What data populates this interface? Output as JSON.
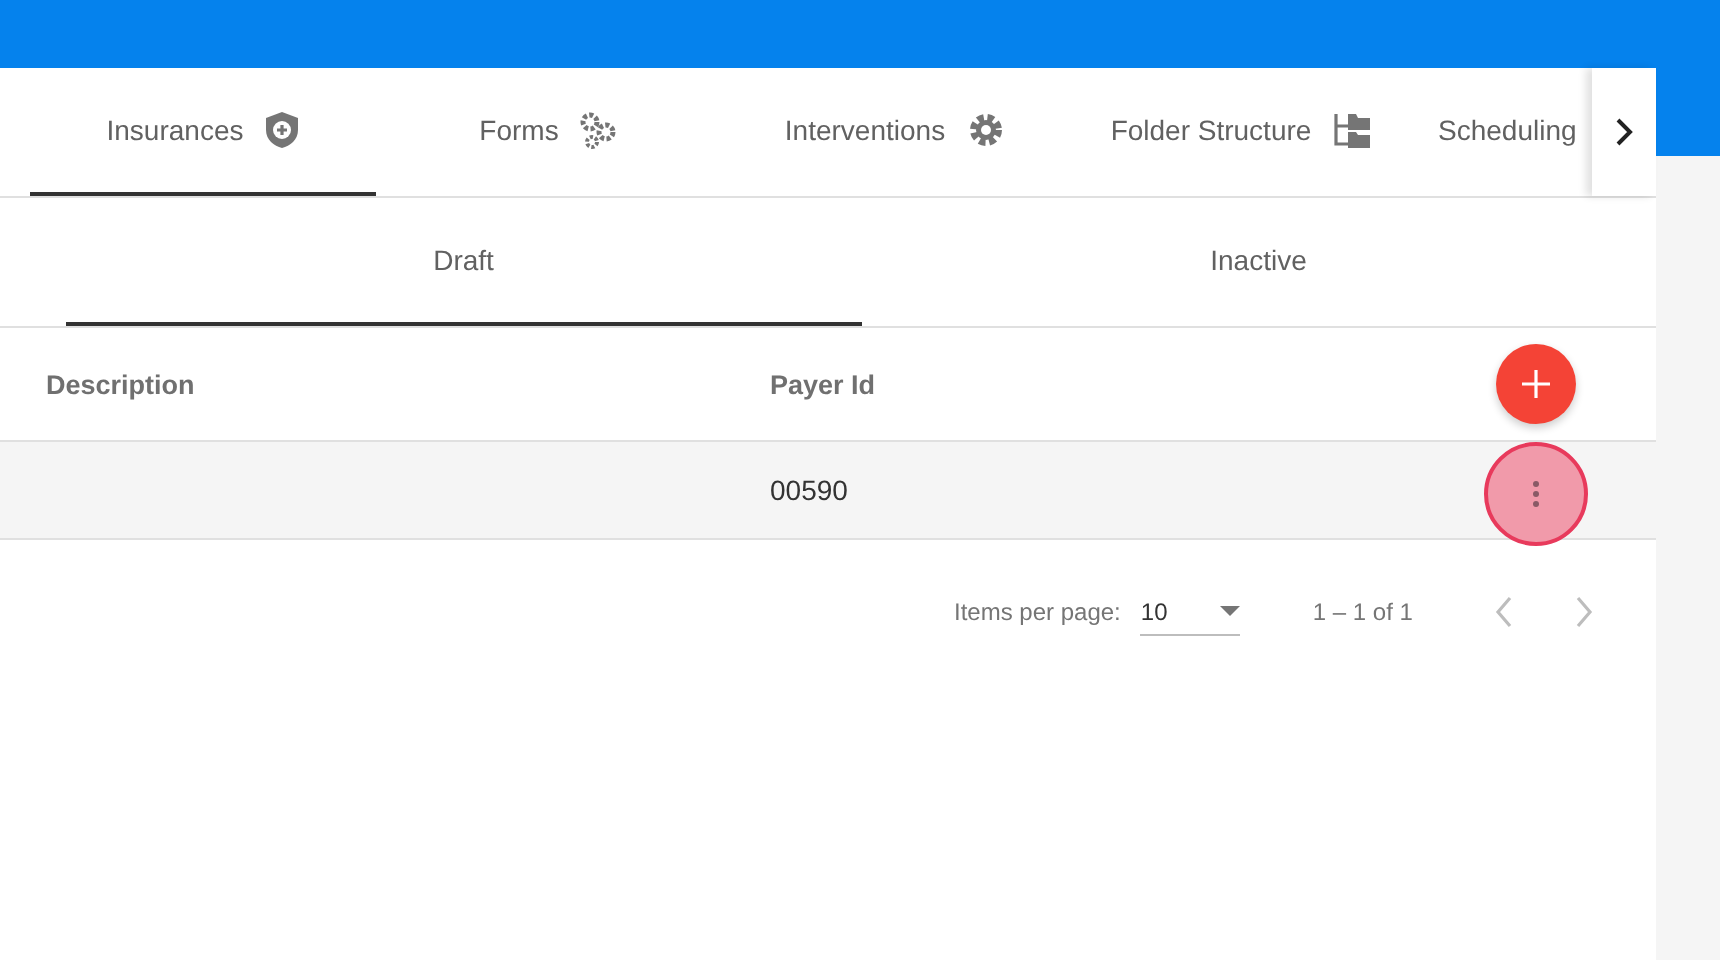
{
  "tabs": [
    {
      "label": "Insurances",
      "kind": "shield",
      "selected": true
    },
    {
      "label": "Forms",
      "kind": "gears",
      "selected": false
    },
    {
      "label": "Interventions",
      "kind": "gear",
      "selected": false
    },
    {
      "label": "Folder Structure",
      "kind": "folders",
      "selected": false
    },
    {
      "label": "Scheduling",
      "selected": false
    }
  ],
  "subtabs": [
    {
      "label": "Draft",
      "selected": true
    },
    {
      "label": "Inactive",
      "selected": false
    }
  ],
  "table": {
    "columns": [
      "Description",
      "Payer Id"
    ],
    "rows": [
      {
        "cells": [
          "",
          "00590"
        ],
        "menu_pressed": true
      }
    ]
  },
  "paginator": {
    "label": "Items per page:",
    "page_size": "10",
    "range": "1 – 1 of 1"
  }
}
